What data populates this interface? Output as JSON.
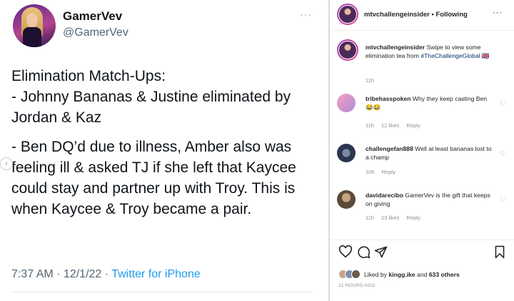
{
  "tweet": {
    "display_name": "GamerVev",
    "handle": "@GamerVev",
    "more": "···",
    "paragraphs": [
      "Elimination Match-Ups:",
      "- Johnny Bananas & Justine eliminated by Jordan & Kaz",
      "- Ben DQ’d due to illness, Amber also was feeling ill & asked TJ if she left that Kaycee could stay and partner up with Troy. This is when Kaycee & Troy became a pair."
    ],
    "time": "7:37 AM · 12/1/22 · ",
    "source": "Twitter for iPhone"
  },
  "instagram": {
    "header": {
      "username": "mtvchallengeinsider",
      "separator": " • ",
      "following": "Following",
      "more": "···"
    },
    "caption": {
      "username": "mtvchallengeinsider",
      "text": " Swipe to view some elimination tea from ",
      "hashtag": "#TheChallengeGlobal",
      "emoji": "🇬🇧",
      "time": "11h"
    },
    "comments": [
      {
        "username": "tribehasspoken",
        "text": " Why they keep casting Ben 😂😂",
        "time": "11h",
        "likes": "12 likes",
        "reply": "Reply"
      },
      {
        "username": "challengefan888",
        "text": " Well at least bananas lost to a champ",
        "time": "10h",
        "likes": "",
        "reply": "Reply"
      },
      {
        "username": "davidarecibo",
        "text": " GamerVev is the gift that keeps on giving",
        "time": "11h",
        "likes": "23 likes",
        "reply": "Reply"
      }
    ],
    "likes": {
      "prefix": "Liked by ",
      "user": "kingg.ike",
      "middle": " and ",
      "count": "633 others"
    },
    "posted_ago": "11 HOURS AGO"
  }
}
